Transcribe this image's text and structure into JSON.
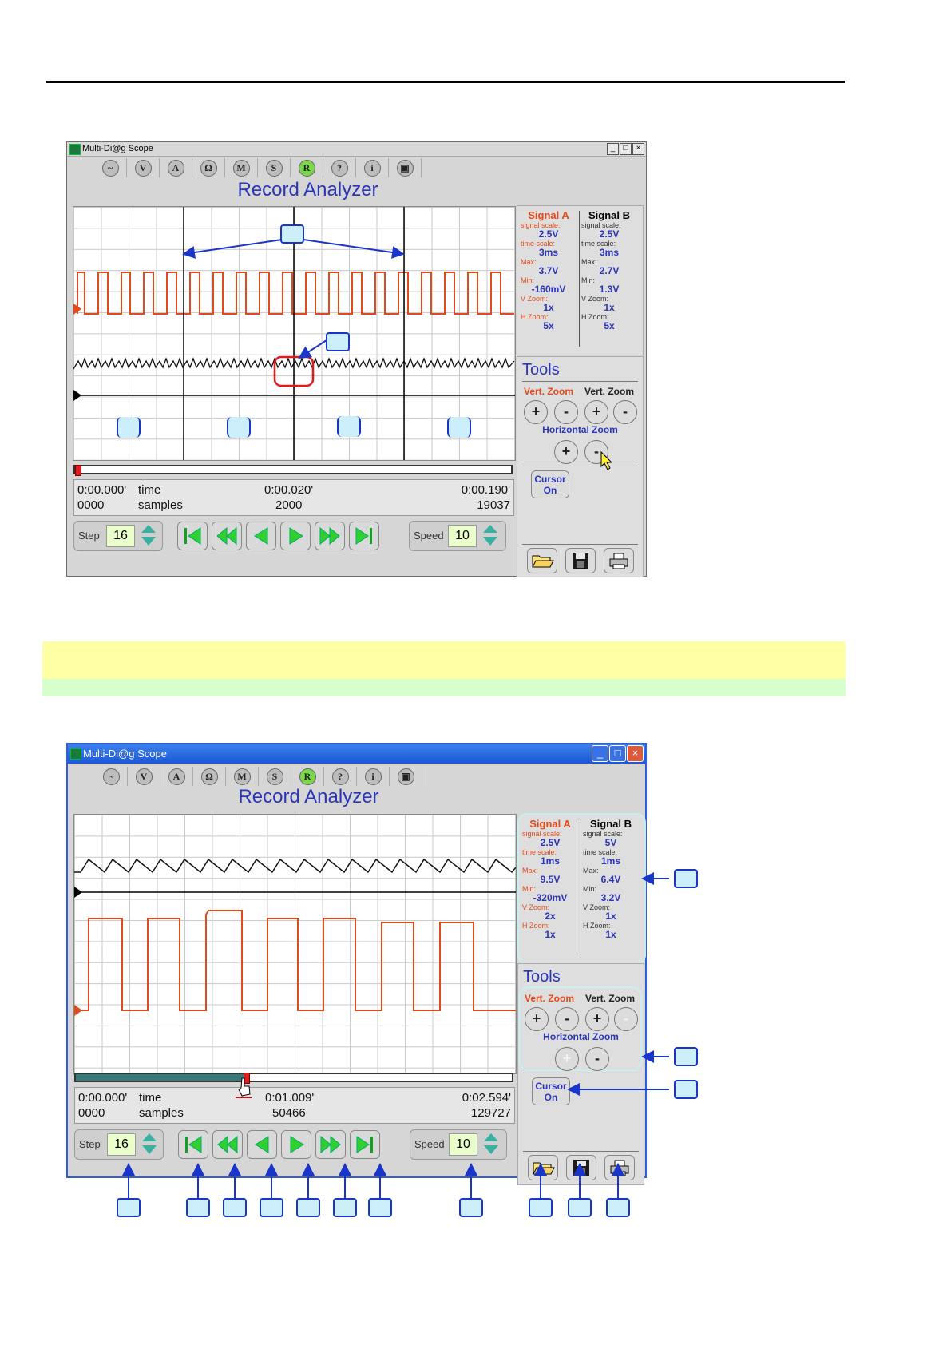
{
  "window1": {
    "title": "Multi-Di@g Scope",
    "heading": "Record Analyzer",
    "toolbar": [
      "~",
      "V",
      "A",
      "Ω",
      "M",
      "S",
      "R",
      "?",
      "i",
      "▣"
    ],
    "signal_a": {
      "header": "Signal A",
      "scale_label": "signal scale:",
      "scale": "2.5V",
      "time_label": "time scale:",
      "time": "3ms",
      "max_label": "Max:",
      "max": "3.7V",
      "min_label": "Min:",
      "min": "-160mV",
      "vzoom_label": "V Zoom:",
      "vzoom": "1x",
      "hzoom_label": "H Zoom:",
      "hzoom": "5x"
    },
    "signal_b": {
      "header": "Signal B",
      "scale_label": "signal scale:",
      "scale": "2.5V",
      "time_label": "time scale:",
      "time": "3ms",
      "max_label": "Max:",
      "max": "2.7V",
      "min_label": "Min:",
      "min": "1.3V",
      "vzoom_label": "V Zoom:",
      "vzoom": "1x",
      "hzoom_label": "H Zoom:",
      "hzoom": "5x"
    },
    "tools": {
      "title": "Tools",
      "vert_zoom_a": "Vert. Zoom",
      "vert_zoom_b": "Vert. Zoom",
      "horizontal_zoom": "Horizontal Zoom",
      "cursor_line1": "Cursor",
      "cursor_line2": "On"
    },
    "info": {
      "time_start": "0:00.000'",
      "time_word": "time",
      "time_mid": "0:00.020'",
      "time_end": "0:00.190'",
      "samples_start": "0000",
      "samples_word": "samples",
      "samples_mid": "2000",
      "samples_end": "19037"
    },
    "controls": {
      "step_label": "Step",
      "step_value": "16",
      "speed_label": "Speed",
      "speed_value": "10"
    },
    "progress_fraction": 0.0
  },
  "window2": {
    "title": "Multi-Di@g Scope",
    "heading": "Record Analyzer",
    "toolbar": [
      "~",
      "V",
      "A",
      "Ω",
      "M",
      "S",
      "R",
      "?",
      "i",
      "▣"
    ],
    "signal_a": {
      "header": "Signal A",
      "scale_label": "signal scale:",
      "scale": "2.5V",
      "time_label": "time scale:",
      "time": "1ms",
      "max_label": "Max:",
      "max": "9.5V",
      "min_label": "Min:",
      "min": "-320mV",
      "vzoom_label": "V Zoom:",
      "vzoom": "2x",
      "hzoom_label": "H Zoom:",
      "hzoom": "1x"
    },
    "signal_b": {
      "header": "Signal B",
      "scale_label": "signal scale:",
      "scale": "5V",
      "time_label": "time scale:",
      "time": "1ms",
      "max_label": "Max:",
      "max": "6.4V",
      "min_label": "Min:",
      "min": "3.2V",
      "vzoom_label": "V Zoom:",
      "vzoom": "1x",
      "hzoom_label": "H Zoom:",
      "hzoom": "1x"
    },
    "tools": {
      "title": "Tools",
      "vert_zoom_a": "Vert. Zoom",
      "vert_zoom_b": "Vert. Zoom",
      "horizontal_zoom": "Horizontal Zoom",
      "cursor_line1": "Cursor",
      "cursor_line2": "On"
    },
    "info": {
      "time_start": "0:00.000'",
      "time_word": "time",
      "time_mid": "0:01.009'",
      "time_end": "0:02.594'",
      "samples_start": "0000",
      "samples_word": "samples",
      "samples_mid": "50466",
      "samples_end": "129727"
    },
    "controls": {
      "step_label": "Step",
      "step_value": "16",
      "speed_label": "Speed",
      "speed_value": "10"
    },
    "progress_fraction": 0.39
  },
  "icons": {
    "first": "skip-to-start-icon",
    "rewind": "fast-rewind-icon",
    "back": "step-back-icon",
    "play": "play-icon",
    "forward": "fast-forward-icon",
    "last": "skip-to-end-icon",
    "open": "folder-open-icon",
    "save": "save-disk-icon",
    "print": "printer-icon"
  },
  "colors": {
    "signal_a": "#e14a1b",
    "signal_b": "#1a1a1a",
    "heading": "#2b35b8",
    "callout_border": "#1a35c9",
    "callout_fill": "#cdeefb",
    "highlight_band_yellow": "#ffffa6",
    "highlight_band_green": "#d6ffcc"
  }
}
